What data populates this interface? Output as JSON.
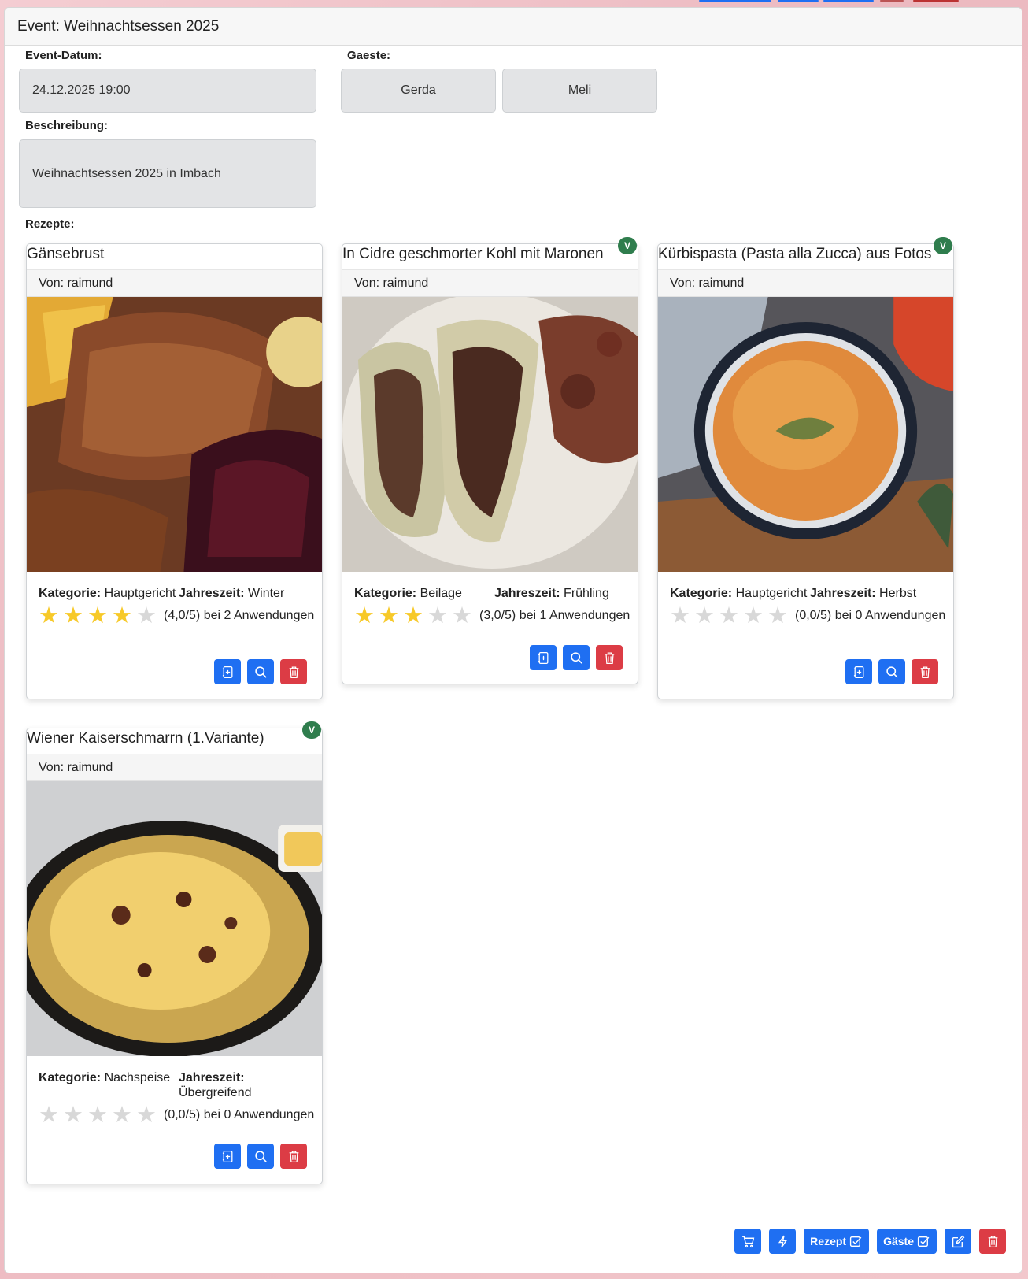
{
  "header": {
    "title": "Event: Weihnachtsessen 2025"
  },
  "labels": {
    "datum": "Event-Datum:",
    "gaeste": "Gaeste:",
    "beschreibung": "Beschreibung:",
    "rezepte": "Rezepte:"
  },
  "event": {
    "datum": "24.12.2025 19:00",
    "beschreibung": "Weihnachtsessen 2025 in Imbach",
    "guests": [
      "Gerda",
      "Meli"
    ]
  },
  "recipes": [
    {
      "title": "Gänsebrust",
      "author": "Von: raimund",
      "cat_key": "Kategorie:",
      "category": "Hauptgericht",
      "season_key": "Jahreszeit:",
      "season": "Winter",
      "stars": 4,
      "rating_text": "(4,0/5) bei 2 Anwendungen",
      "vegetarian": false
    },
    {
      "title": "In Cidre geschmorter Kohl mit Maronen",
      "author": "Von: raimund",
      "cat_key": "Kategorie:",
      "category": "Beilage",
      "season_key": "Jahreszeit:",
      "season": "Frühling",
      "stars": 3,
      "rating_text": "(3,0/5) bei 1 Anwendungen",
      "vegetarian": true,
      "badge": "V"
    },
    {
      "title": "Kürbispasta (Pasta alla Zucca) aus Fotos",
      "author": "Von: raimund",
      "cat_key": "Kategorie:",
      "category": "Hauptgericht",
      "season_key": "Jahreszeit:",
      "season": "Herbst",
      "stars": 0,
      "rating_text": "(0,0/5) bei 0 Anwendungen",
      "vegetarian": true,
      "badge": "V"
    },
    {
      "title": "Wiener Kaiserschmarrn (1.Variante)",
      "author": "Von: raimund",
      "cat_key": "Kategorie:",
      "category": "Nachspeise",
      "season_key": "Jahreszeit:",
      "season": "Übergreifend",
      "stars": 0,
      "rating_text": "(0,0/5) bei 0 Anwendungen",
      "vegetarian": true,
      "badge": "V"
    }
  ],
  "footer": {
    "rezept_label": "Rezept",
    "gaeste_label": "Gäste"
  },
  "colors": {
    "primary": "#1f6ff2",
    "danger": "#dc3c45",
    "badge": "#2f7d4d",
    "star_on": "#f7c928",
    "star_off": "#d8d8d8"
  }
}
